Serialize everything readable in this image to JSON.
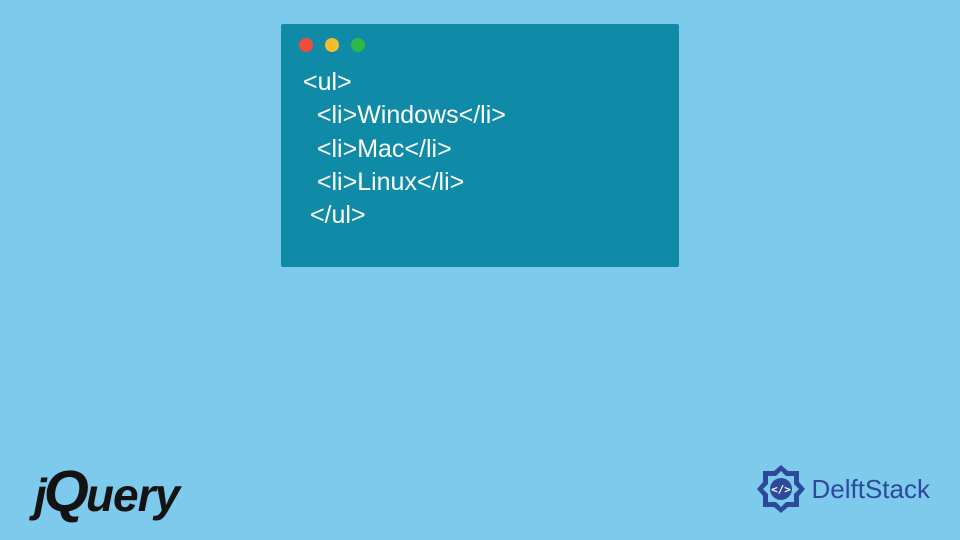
{
  "code": {
    "line1": "<ul>",
    "line2": "  <li>Windows</li>",
    "line3": "  <li>Mac</li>",
    "line4": "  <li>Linux</li>",
    "line5": " </ul>"
  },
  "logos": {
    "jquery_j": "j",
    "jquery_q": "Q",
    "jquery_rest": "uery",
    "delftstack": "DelftStack"
  }
}
